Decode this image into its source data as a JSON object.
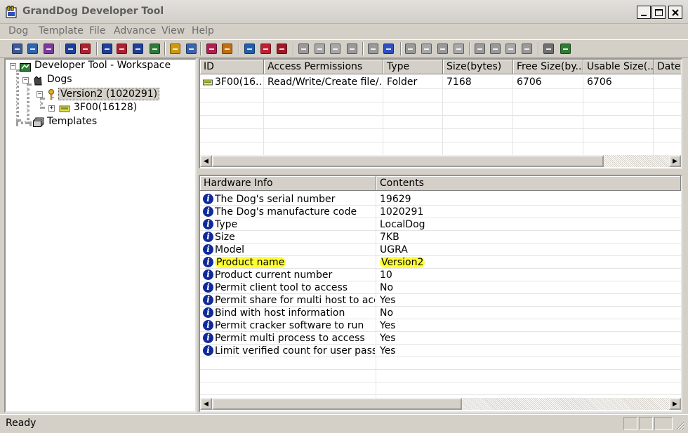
{
  "window": {
    "title": "GrandDog Developer Tool"
  },
  "menu": [
    "Dog",
    "Template",
    "File",
    "Advance",
    "View",
    "Help"
  ],
  "toolbar_icons": [
    "dog-search-icon",
    "dog-save-icon",
    "dog-edit-icon",
    "lock-blue-icon",
    "lock-red-icon",
    "lock-open-icon",
    "lock-key-icon",
    "lock-user-icon",
    "lock-check-icon",
    "key-add-icon",
    "key-copy-icon",
    "program-icon",
    "flash-icon",
    "file-new-icon",
    "file-edit-icon",
    "file-delete-icon",
    "disk-gray-icon",
    "doc-gray-icon",
    "doc-copy-gray-icon",
    "doc-move-gray-icon",
    "computer-gray-icon",
    "probe-icon",
    "folder-gray-icon",
    "chart-gray-icon",
    "stack-gray-icon",
    "image-gray-icon",
    "list-gray-icon",
    "find-gray-icon",
    "report-gray-icon",
    "export-gray-icon",
    "tools-icon",
    "reader-icon"
  ],
  "tree": {
    "root": "Developer Tool - Workspace",
    "dogs": "Dogs",
    "version": "Version2 (1020291)",
    "folder": "3F00(16128)",
    "templates": "Templates"
  },
  "files": {
    "columns": [
      "ID",
      "Access Permissions",
      "Type",
      "Size(bytes)",
      "Free Size(by...",
      "Usable Size(...",
      "Date"
    ],
    "rows": [
      [
        "3F00(16...",
        "Read/Write/Create file/...",
        "Folder",
        "7168",
        "6706",
        "6706",
        ""
      ]
    ]
  },
  "hardware": {
    "columns": [
      "Hardware Info",
      "Contents"
    ],
    "rows": [
      [
        "The Dog's serial number",
        "19629"
      ],
      [
        "The Dog's manufacture code",
        "1020291"
      ],
      [
        "Type",
        "LocalDog"
      ],
      [
        "Size",
        "7KB"
      ],
      [
        "Model",
        "UGRA"
      ],
      [
        "Product name",
        "Version2"
      ],
      [
        "Product current number",
        "10"
      ],
      [
        "Permit client tool to access",
        "No"
      ],
      [
        "Permit share for multi host to access",
        "Yes"
      ],
      [
        "Bind with host information",
        "No"
      ],
      [
        "Permit cracker software to run",
        "Yes"
      ],
      [
        "Permit multi process to access",
        "Yes"
      ],
      [
        "Limit verified count for user password",
        "Yes"
      ]
    ],
    "highlighted_row": 5,
    "highlight_color": "#ffff33"
  },
  "status": {
    "text": "Ready"
  },
  "colors": {
    "info_icon": "#102a9a",
    "window_bg": "#d4d0c8"
  }
}
